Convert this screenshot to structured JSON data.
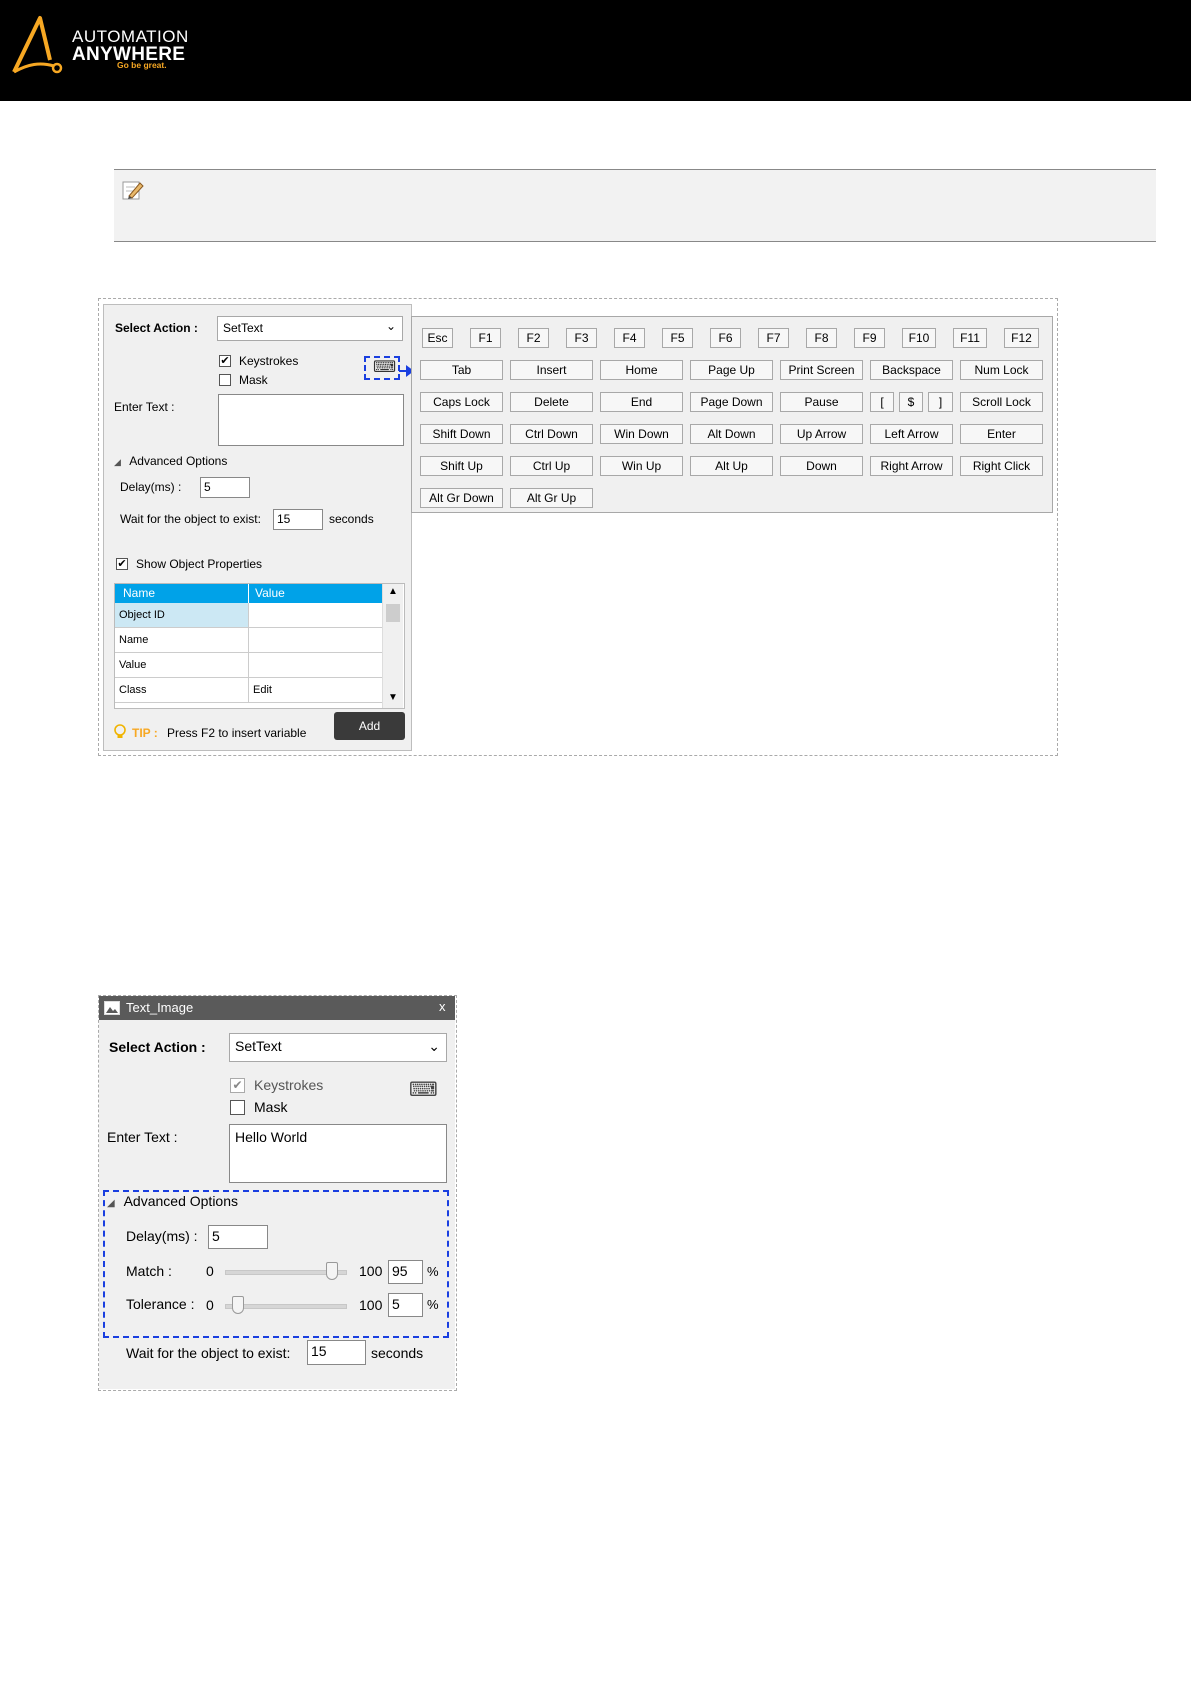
{
  "header": {
    "logo_line1": "AUTOMATION",
    "logo_line2": "ANYWHERE",
    "logo_tagline": "Go be great.",
    "colors": {
      "background": "#000000",
      "accent": "#f7a823"
    }
  },
  "note": {
    "icon": "pencil-note-icon"
  },
  "panel1": {
    "select_action_label": "Select Action :",
    "select_action_value": "SetText",
    "keystrokes_label": "Keystrokes",
    "keystrokes_checked": true,
    "mask_label": "Mask",
    "mask_checked": false,
    "keyboard_icon": "keyboard-icon",
    "enter_text_label": "Enter Text :",
    "enter_text_value": "",
    "advanced_options_label": "Advanced Options",
    "delay_label": "Delay(ms) :",
    "delay_value": "5",
    "wait_label": "Wait for the object to exist:",
    "wait_value": "15",
    "wait_unit": "seconds",
    "show_props_label": "Show Object Properties",
    "show_props_checked": true,
    "table": {
      "columns": [
        "Name",
        "Value"
      ],
      "rows": [
        [
          "Object ID",
          ""
        ],
        [
          "Name",
          ""
        ],
        [
          "Value",
          ""
        ],
        [
          "Class",
          "Edit"
        ]
      ]
    },
    "tip_label": "TIP :",
    "tip_text": "Press F2 to insert variable",
    "add_label": "Add"
  },
  "keyboard": {
    "rows": [
      [
        "Esc",
        "F1",
        "F2",
        "F3",
        "F4",
        "F5",
        "F6",
        "F7",
        "F8",
        "F9",
        "F10",
        "F11",
        "F12"
      ],
      [
        "Tab",
        "Insert",
        "Home",
        "Page Up",
        "Print Screen",
        "Backspace",
        "Num Lock"
      ],
      [
        "Caps Lock",
        "Delete",
        "End",
        "Page Down",
        "Pause",
        "[",
        "$",
        "]",
        "Scroll Lock"
      ],
      [
        "Shift Down",
        "Ctrl Down",
        "Win Down",
        "Alt Down",
        "Up Arrow",
        "Left Arrow",
        "Enter"
      ],
      [
        "Shift Up",
        "Ctrl Up",
        "Win Up",
        "Alt Up",
        "Down",
        "Right Arrow",
        "Right Click"
      ],
      [
        "Alt Gr Down",
        "Alt Gr Up"
      ]
    ]
  },
  "panel2": {
    "title": "Text_Image",
    "close": "x",
    "select_action_label": "Select Action :",
    "select_action_value": "SetText",
    "keystrokes_label": "Keystrokes",
    "keystrokes_checked": true,
    "mask_label": "Mask",
    "mask_checked": false,
    "enter_text_label": "Enter Text :",
    "enter_text_value": "Hello World",
    "advanced_options_label": "Advanced Options",
    "delay_label": "Delay(ms) :",
    "delay_value": "5",
    "match_label": "Match :",
    "match_min": "0",
    "match_max": "100",
    "match_value": "95",
    "tolerance_label": "Tolerance :",
    "tolerance_min": "0",
    "tolerance_max": "100",
    "tolerance_value": "5",
    "percent": "%",
    "wait_label": "Wait for the object to exist:",
    "wait_value": "15",
    "wait_unit": "seconds"
  },
  "highlight_color": "#1a3fe0"
}
